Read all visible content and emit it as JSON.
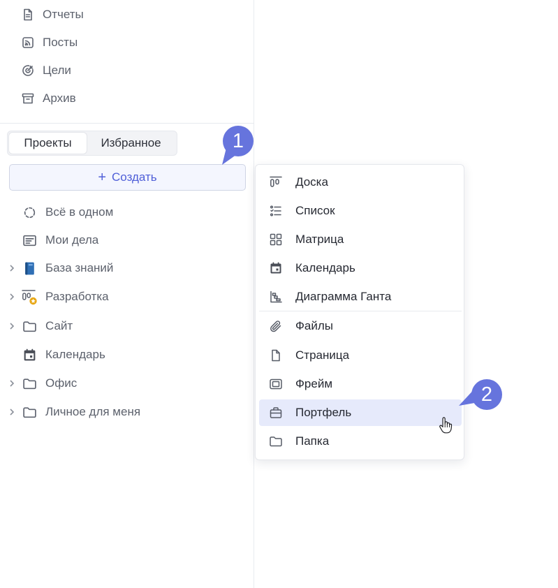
{
  "sidebar": {
    "nav": [
      {
        "label": "Отчеты",
        "icon": "report-icon"
      },
      {
        "label": "Посты",
        "icon": "rss-icon"
      },
      {
        "label": "Цели",
        "icon": "target-icon"
      },
      {
        "label": "Архив",
        "icon": "archive-icon"
      }
    ],
    "tabs": [
      "Проекты",
      "Избранное"
    ],
    "create_label": "Создать",
    "projects": [
      {
        "label": "Всё в одном",
        "icon": "all-in-one-icon",
        "expandable": false
      },
      {
        "label": "Мои дела",
        "icon": "my-tasks-icon",
        "expandable": false
      },
      {
        "label": "База знаний",
        "icon": "book-icon",
        "expandable": true
      },
      {
        "label": "Разработка",
        "icon": "board-star-icon",
        "expandable": true
      },
      {
        "label": "Сайт",
        "icon": "folder-icon",
        "expandable": true
      },
      {
        "label": "Календарь",
        "icon": "calendar-icon",
        "expandable": false
      },
      {
        "label": "Офис",
        "icon": "folder-icon",
        "expandable": true
      },
      {
        "label": "Личное для меня",
        "icon": "folder-icon",
        "expandable": true
      }
    ]
  },
  "callouts": [
    "1",
    "2"
  ],
  "menu": {
    "items": [
      {
        "label": "Доска",
        "icon": "board-icon"
      },
      {
        "label": "Список",
        "icon": "list-icon"
      },
      {
        "label": "Матрица",
        "icon": "matrix-icon"
      },
      {
        "label": "Календарь",
        "icon": "calendar-icon"
      },
      {
        "label": "Диаграмма Ганта",
        "icon": "gantt-icon"
      },
      {
        "label": "Файлы",
        "icon": "paperclip-icon"
      },
      {
        "label": "Страница",
        "icon": "page-icon"
      },
      {
        "label": "Фрейм",
        "icon": "frame-icon"
      },
      {
        "label": "Портфель",
        "icon": "briefcase-icon"
      },
      {
        "label": "Папка",
        "icon": "folder-icon"
      }
    ],
    "active_index": 8
  },
  "colors": {
    "accent": "#4f5fd8",
    "callout": "#6674dd",
    "active_bg": "#e6eafb",
    "star_badge": "#e8a817",
    "book": "#2f6fb5"
  }
}
